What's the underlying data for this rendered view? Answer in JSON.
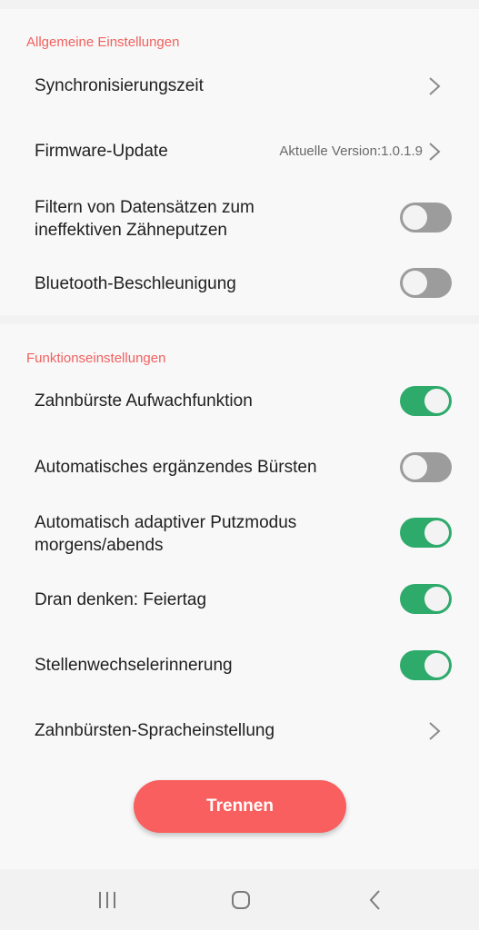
{
  "general": {
    "title": "Allgemeine Einstellungen",
    "sync_label": "Synchronisierungszeit",
    "firmware_label": "Firmware-Update",
    "firmware_value": "Aktuelle Version:1.0.1.9",
    "filter_label": "Filtern von Datensätzen zum ineffektiven Zähneputzen",
    "filter_on": false,
    "bluetooth_label": "Bluetooth-Beschleunigung",
    "bluetooth_on": false
  },
  "functions": {
    "title": "Funktionseinstellungen",
    "wakeup_label": "Zahnbürste Aufwachfunktion",
    "wakeup_on": true,
    "auto_brush_label": "Automatisches ergänzendes Bürsten",
    "auto_brush_on": false,
    "adaptive_label": "Automatisch adaptiver Putzmodus morgens/abends",
    "adaptive_on": true,
    "holiday_label": "Dran denken: Feiertag",
    "holiday_on": true,
    "position_label": "Stellenwechselerinnerung",
    "position_on": true,
    "language_label": "Zahnbürsten-Spracheinstellung"
  },
  "actions": {
    "disconnect_label": "Trennen"
  },
  "colors": {
    "accent": "#f0615f",
    "button": "#f85f5e",
    "toggle_on": "#2eaa6b",
    "toggle_off": "#9c9c9c"
  },
  "navbar": {
    "recent_icon": "recent-apps-icon",
    "home_icon": "home-icon",
    "back_icon": "back-icon"
  }
}
